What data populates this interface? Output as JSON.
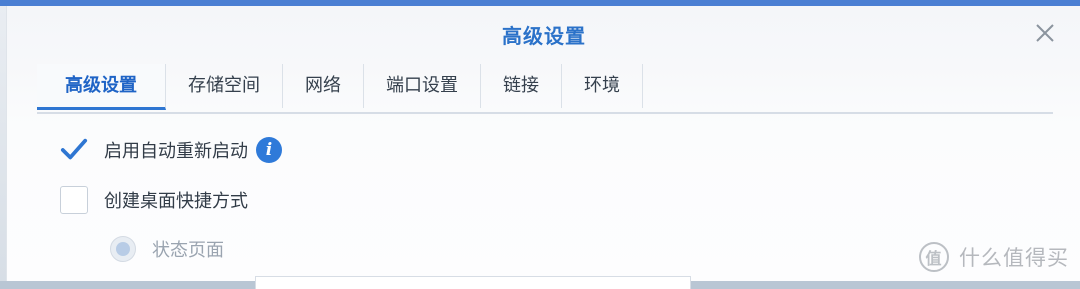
{
  "dialog": {
    "title": "高级设置"
  },
  "tabs": [
    {
      "label": "高级设置",
      "active": true
    },
    {
      "label": "存储空间",
      "active": false
    },
    {
      "label": "网络",
      "active": false
    },
    {
      "label": "端口设置",
      "active": false
    },
    {
      "label": "链接",
      "active": false
    },
    {
      "label": "环境",
      "active": false
    }
  ],
  "options": {
    "auto_restart": {
      "label": "启用自动重新启动",
      "checked": true
    },
    "desktop_shortcut": {
      "label": "创建桌面快捷方式",
      "checked": false
    },
    "status_page": {
      "label": "状态页面",
      "selected": true,
      "disabled": true
    }
  },
  "watermark": {
    "logo_char": "值",
    "text": "什么值得买"
  },
  "colors": {
    "accent": "#2e76d2",
    "title": "#2b72c9",
    "info": "#2f7ad9"
  }
}
